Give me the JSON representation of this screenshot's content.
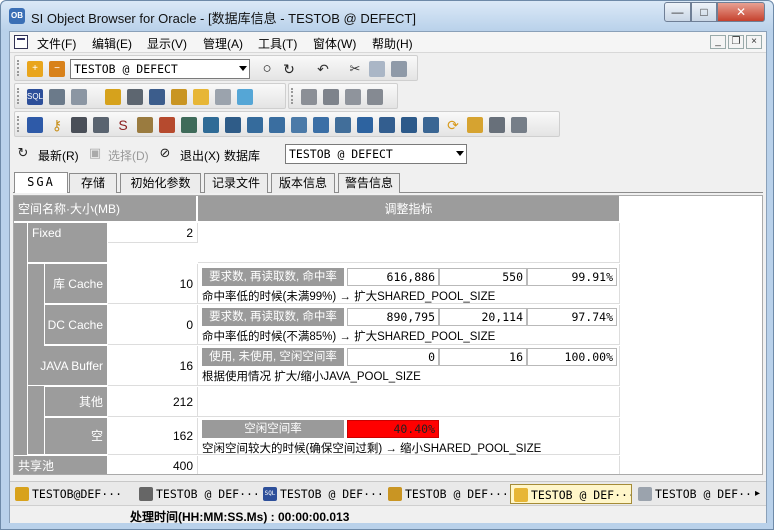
{
  "window": {
    "title": "SI Object Browser for Oracle - [数据库信息 - TESTOB @ DEFECT]",
    "app_icon": "OB",
    "minimize": "—",
    "maximize": "□",
    "close": "✕"
  },
  "menu": {
    "items": [
      "文件(F)",
      "编辑(E)",
      "显示(V)",
      "管理(A)",
      "工具(T)",
      "窗体(W)",
      "帮助(H)"
    ],
    "mdi_min": "_",
    "mdi_restore": "❐",
    "mdi_close": "×"
  },
  "toolbar": {
    "connection_combo": "TESTOB @ DEFECT"
  },
  "actions": {
    "refresh": "最新(R)",
    "select": "选择(D)",
    "exit": "退出(X)",
    "database_label": "数据库",
    "database_combo": "TESTOB @ DEFECT"
  },
  "tabs": [
    "SGA",
    "存储",
    "初始化参数",
    "记录文件",
    "版本信息",
    "警告信息"
  ],
  "grid": {
    "col_name": "空间名称·大小(MB)",
    "col_tuning": "调整指标",
    "rows": [
      {
        "name": "Fixed",
        "size": "2"
      },
      {
        "name": "库 Cache",
        "size": "10",
        "label": "要求数, 再读取数, 命中率",
        "v1": "616,886",
        "v2": "550",
        "v3": "99.91%",
        "note": "命中率低的时候(未满99%) → 扩大SHARED_POOL_SIZE"
      },
      {
        "name": "DC Cache",
        "size": "0",
        "label": "要求数, 再读取数, 命中率",
        "v1": "890,795",
        "v2": "20,114",
        "v3": "97.74%",
        "note": "命中率低的时候(不满85%) → 扩大SHARED_POOL_SIZE"
      },
      {
        "name": "JAVA Buffer",
        "size": "16",
        "label": "使用, 未使用, 空闲空间率",
        "v1": "0",
        "v2": "16",
        "v3": "100.00%",
        "note": "根据使用情况 扩大/缩小JAVA_POOL_SIZE"
      },
      {
        "name": "其他",
        "size": "212"
      },
      {
        "name": "空",
        "size": "162",
        "label": "空闲空间率",
        "v1": "40.40%",
        "note": "空闲空间较大的时候(确保空间过剩) → 缩小SHARED_POOL_SIZE"
      },
      {
        "name": "共享池",
        "size": "400"
      }
    ],
    "alert_color": "#ff0000"
  },
  "window_tabs": [
    {
      "label": "TESTOB@DEF···",
      "icon": "db-icon"
    },
    {
      "label": "TESTOB @ DEF···",
      "icon": "table-icon"
    },
    {
      "label": "TESTOB @ DEF···",
      "icon": "sql-icon"
    },
    {
      "label": "TESTOB @ DEF···",
      "icon": "lock-icon"
    },
    {
      "label": "TESTOB @ DEF···",
      "icon": "database-icon"
    },
    {
      "label": "TESTOB @ DEF···",
      "icon": "object-icon"
    }
  ],
  "more": "▸",
  "status": {
    "text": "处理时间(HH:MM:SS.Ms) : 00:00:00.013"
  }
}
